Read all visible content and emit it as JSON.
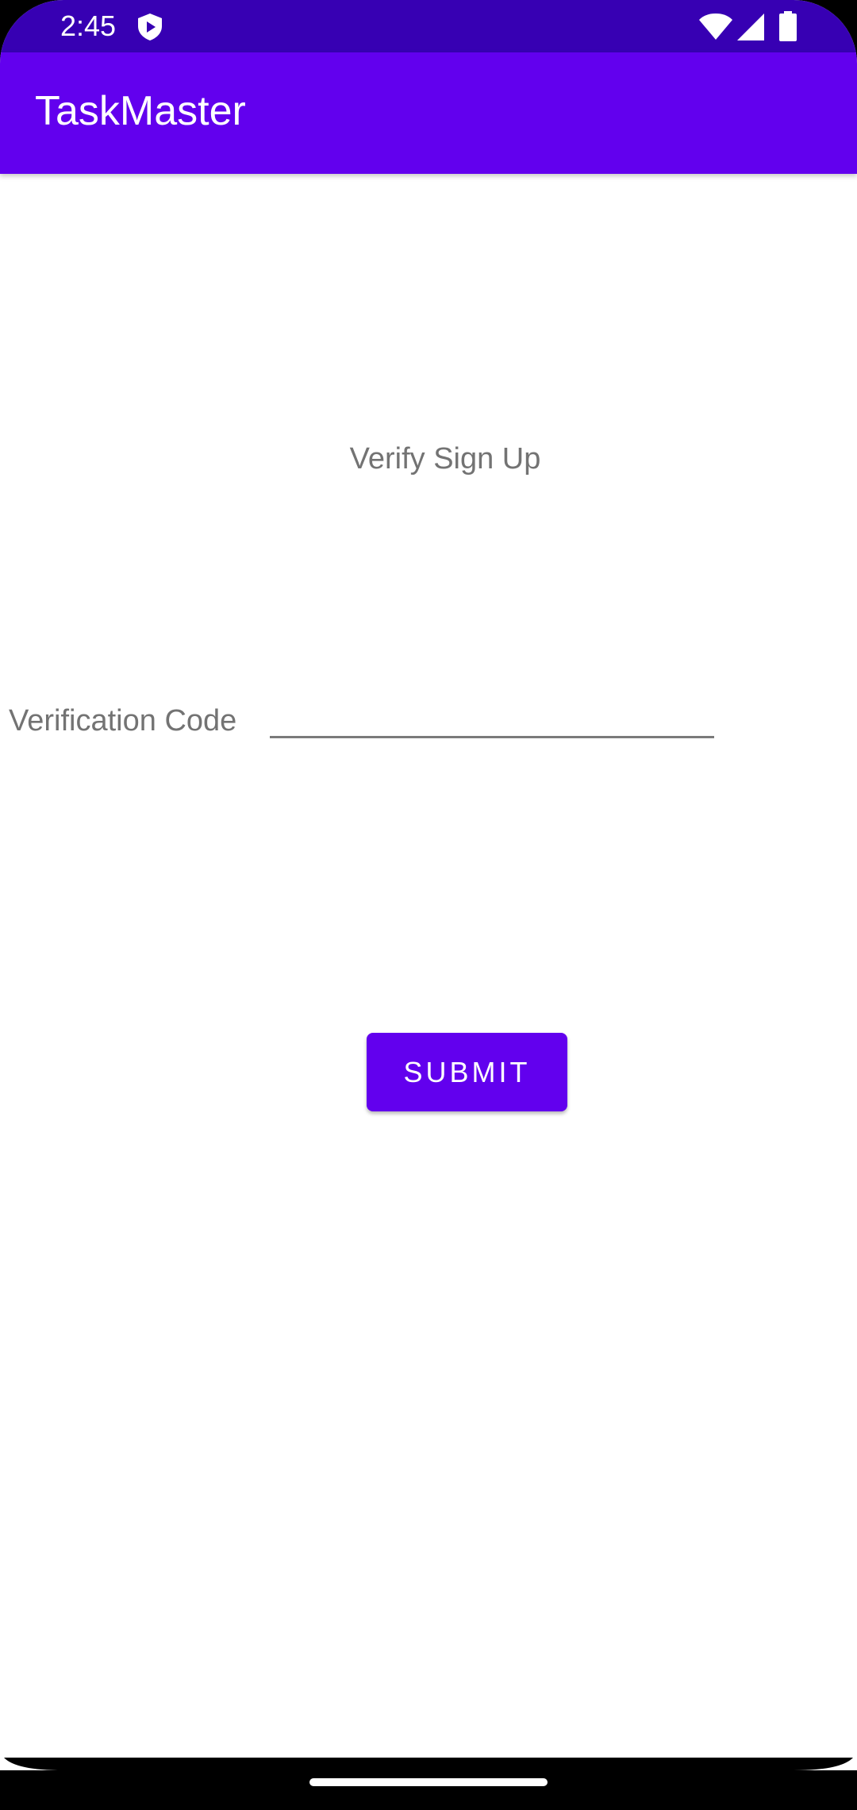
{
  "status_bar": {
    "time": "2:45",
    "icons": [
      "shield-play-icon",
      "wifi-icon",
      "cell-signal-icon",
      "battery-icon"
    ]
  },
  "app_bar": {
    "title": "TaskMaster"
  },
  "screen": {
    "heading": "Verify Sign Up",
    "code_field": {
      "label": "Verification Code",
      "value": "",
      "placeholder": ""
    },
    "submit_label": "SUBMIT"
  },
  "colors": {
    "status_bar": "#3700B3",
    "primary": "#6200EE",
    "text_secondary": "#737373",
    "background": "#FFFFFF"
  }
}
